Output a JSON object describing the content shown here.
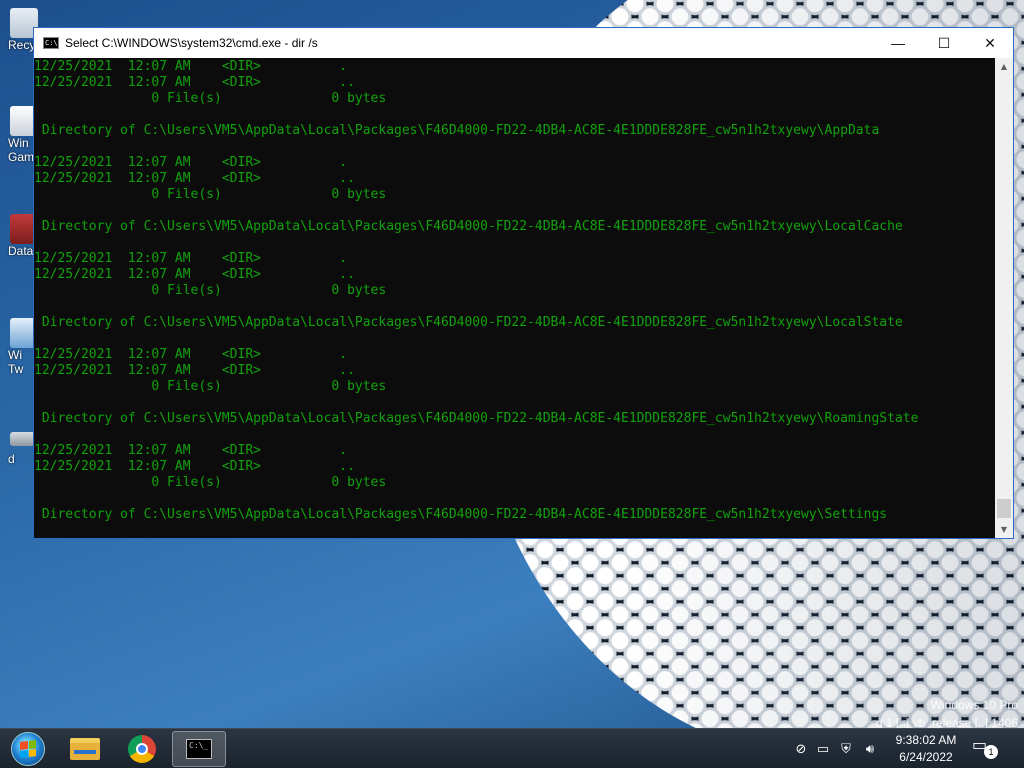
{
  "desktop": {
    "icons": [
      {
        "label": "Recy",
        "icon": "recycle-bin-icon"
      },
      {
        "label": "Win Gam",
        "icon": "games-icon"
      },
      {
        "label": "Dataw",
        "icon": "shortcut-icon"
      },
      {
        "label": "Wi Tw",
        "icon": "shortcut-icon"
      },
      {
        "label": "d",
        "icon": "drive-icon"
      }
    ],
    "watermark_line1": "Windows 10 Pro",
    "watermark_line2": "d 1 [..] vb_release [..] 1406"
  },
  "window": {
    "title": "Select C:\\WINDOWS\\system32\\cmd.exe - dir /s",
    "app_icon_text": "C:\\",
    "minimize": "—",
    "maximize": "☐",
    "close": "✕",
    "console_lines": [
      "12/25/2021  12:07 AM    <DIR>          .",
      "12/25/2021  12:07 AM    <DIR>          ..",
      "               0 File(s)              0 bytes",
      "",
      " Directory of C:\\Users\\VM5\\AppData\\Local\\Packages\\F46D4000-FD22-4DB4-AC8E-4E1DDDE828FE_cw5n1h2txyewy\\AppData",
      "",
      "12/25/2021  12:07 AM    <DIR>          .",
      "12/25/2021  12:07 AM    <DIR>          ..",
      "               0 File(s)              0 bytes",
      "",
      " Directory of C:\\Users\\VM5\\AppData\\Local\\Packages\\F46D4000-FD22-4DB4-AC8E-4E1DDDE828FE_cw5n1h2txyewy\\LocalCache",
      "",
      "12/25/2021  12:07 AM    <DIR>          .",
      "12/25/2021  12:07 AM    <DIR>          ..",
      "               0 File(s)              0 bytes",
      "",
      " Directory of C:\\Users\\VM5\\AppData\\Local\\Packages\\F46D4000-FD22-4DB4-AC8E-4E1DDDE828FE_cw5n1h2txyewy\\LocalState",
      "",
      "12/25/2021  12:07 AM    <DIR>          .",
      "12/25/2021  12:07 AM    <DIR>          ..",
      "               0 File(s)              0 bytes",
      "",
      " Directory of C:\\Users\\VM5\\AppData\\Local\\Packages\\F46D4000-FD22-4DB4-AC8E-4E1DDDE828FE_cw5n1h2txyewy\\RoamingState",
      "",
      "12/25/2021  12:07 AM    <DIR>          .",
      "12/25/2021  12:07 AM    <DIR>          ..",
      "               0 File(s)              0 bytes",
      "",
      " Directory of C:\\Users\\VM5\\AppData\\Local\\Packages\\F46D4000-FD22-4DB4-AC8E-4E1DDDE828FE_cw5n1h2txyewy\\Settings",
      ""
    ],
    "console_color": "#13a10e"
  },
  "taskbar": {
    "pinned": [
      {
        "name": "start-button",
        "icon": "windows-logo-icon"
      },
      {
        "name": "file-explorer",
        "icon": "folder-icon"
      },
      {
        "name": "chrome",
        "icon": "chrome-icon"
      },
      {
        "name": "command-prompt",
        "icon": "cmd-icon",
        "active": true
      }
    ],
    "tray_icons": [
      "network-off-icon",
      "network-icon",
      "security-icon",
      "volume-icon"
    ],
    "time": "9:38:02 AM",
    "date": "6/24/2022",
    "notification_count": "1"
  }
}
